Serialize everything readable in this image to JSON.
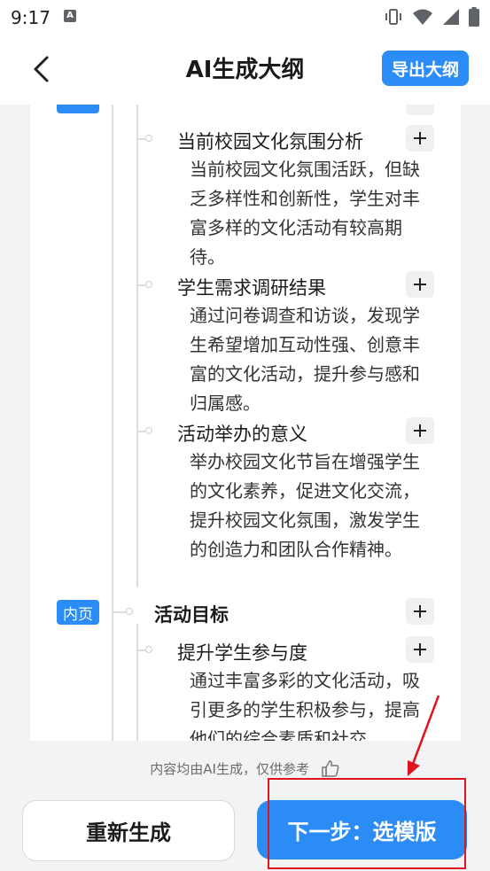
{
  "status_bar": {
    "time": "9:17",
    "app_badge": "A"
  },
  "header": {
    "title": "AI生成大纲",
    "export_label": "导出大纲"
  },
  "outline": {
    "items": [
      {
        "title": "当前校园文化氛围分析",
        "desc": "当前校园文化氛围活跃，但缺乏多样性和创新性，学生对丰富多样的文化活动有较高期待。"
      },
      {
        "title": "学生需求调研结果",
        "desc": "通过问卷调查和访谈，发现学生希望增加互动性强、创意丰富的文化活动，提升参与感和归属感。"
      },
      {
        "title": "活动举办的意义",
        "desc": "举办校园文化节旨在增强学生的文化素养，促进文化交流，提升校园文化氛围，激发学生的创造力和团队合作精神。"
      }
    ],
    "section": {
      "tag": "内页",
      "title": "活动目标",
      "child": {
        "title": "提升学生参与度",
        "desc": "通过丰富多彩的文化活动，吸引更多的学生积极参与，提高他们的综合素质和社交"
      }
    }
  },
  "footer": {
    "disclaimer": "内容均由AI生成，仅供参考",
    "regenerate_label": "重新生成",
    "next_label": "下一步：选模版"
  },
  "colors": {
    "accent": "#2b8cf5",
    "annotation": "#e0141e"
  }
}
